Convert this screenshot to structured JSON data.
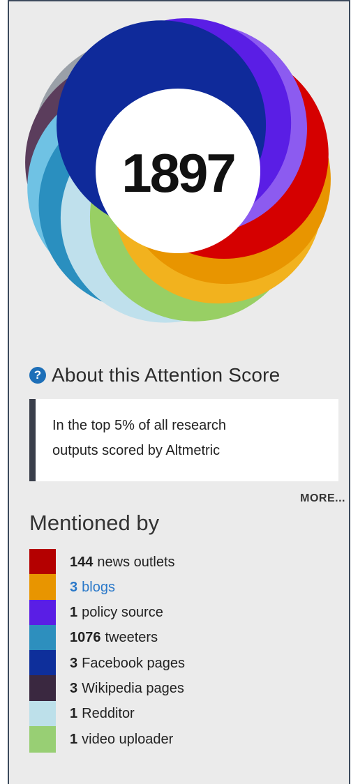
{
  "score": "1897",
  "about": {
    "icon": "question-icon",
    "label": "About this Attention Score"
  },
  "score_box": {
    "line1": "In the top 5% of all research",
    "line2": "outputs scored by Altmetric"
  },
  "more_label": "MORE...",
  "mentioned_heading": "Mentioned by",
  "mentions": [
    {
      "count": "144",
      "label": "news outlets",
      "color": "#b40000",
      "link": false
    },
    {
      "count": "3",
      "label": "blogs",
      "color": "#e89500",
      "link": true
    },
    {
      "count": "1",
      "label": "policy source",
      "color": "#5a1ee5",
      "link": false
    },
    {
      "count": "1076",
      "label": "tweeters",
      "color": "#2d8fbe",
      "link": false
    },
    {
      "count": "3",
      "label": "Facebook pages",
      "color": "#0e2f9b",
      "link": false
    },
    {
      "count": "3",
      "label": "Wikipedia pages",
      "color": "#3a2840",
      "link": false
    },
    {
      "count": "1",
      "label": "Redditor",
      "color": "#bde0ea",
      "link": false
    },
    {
      "count": "1",
      "label": "video uploader",
      "color": "#98cf74",
      "link": false
    }
  ]
}
